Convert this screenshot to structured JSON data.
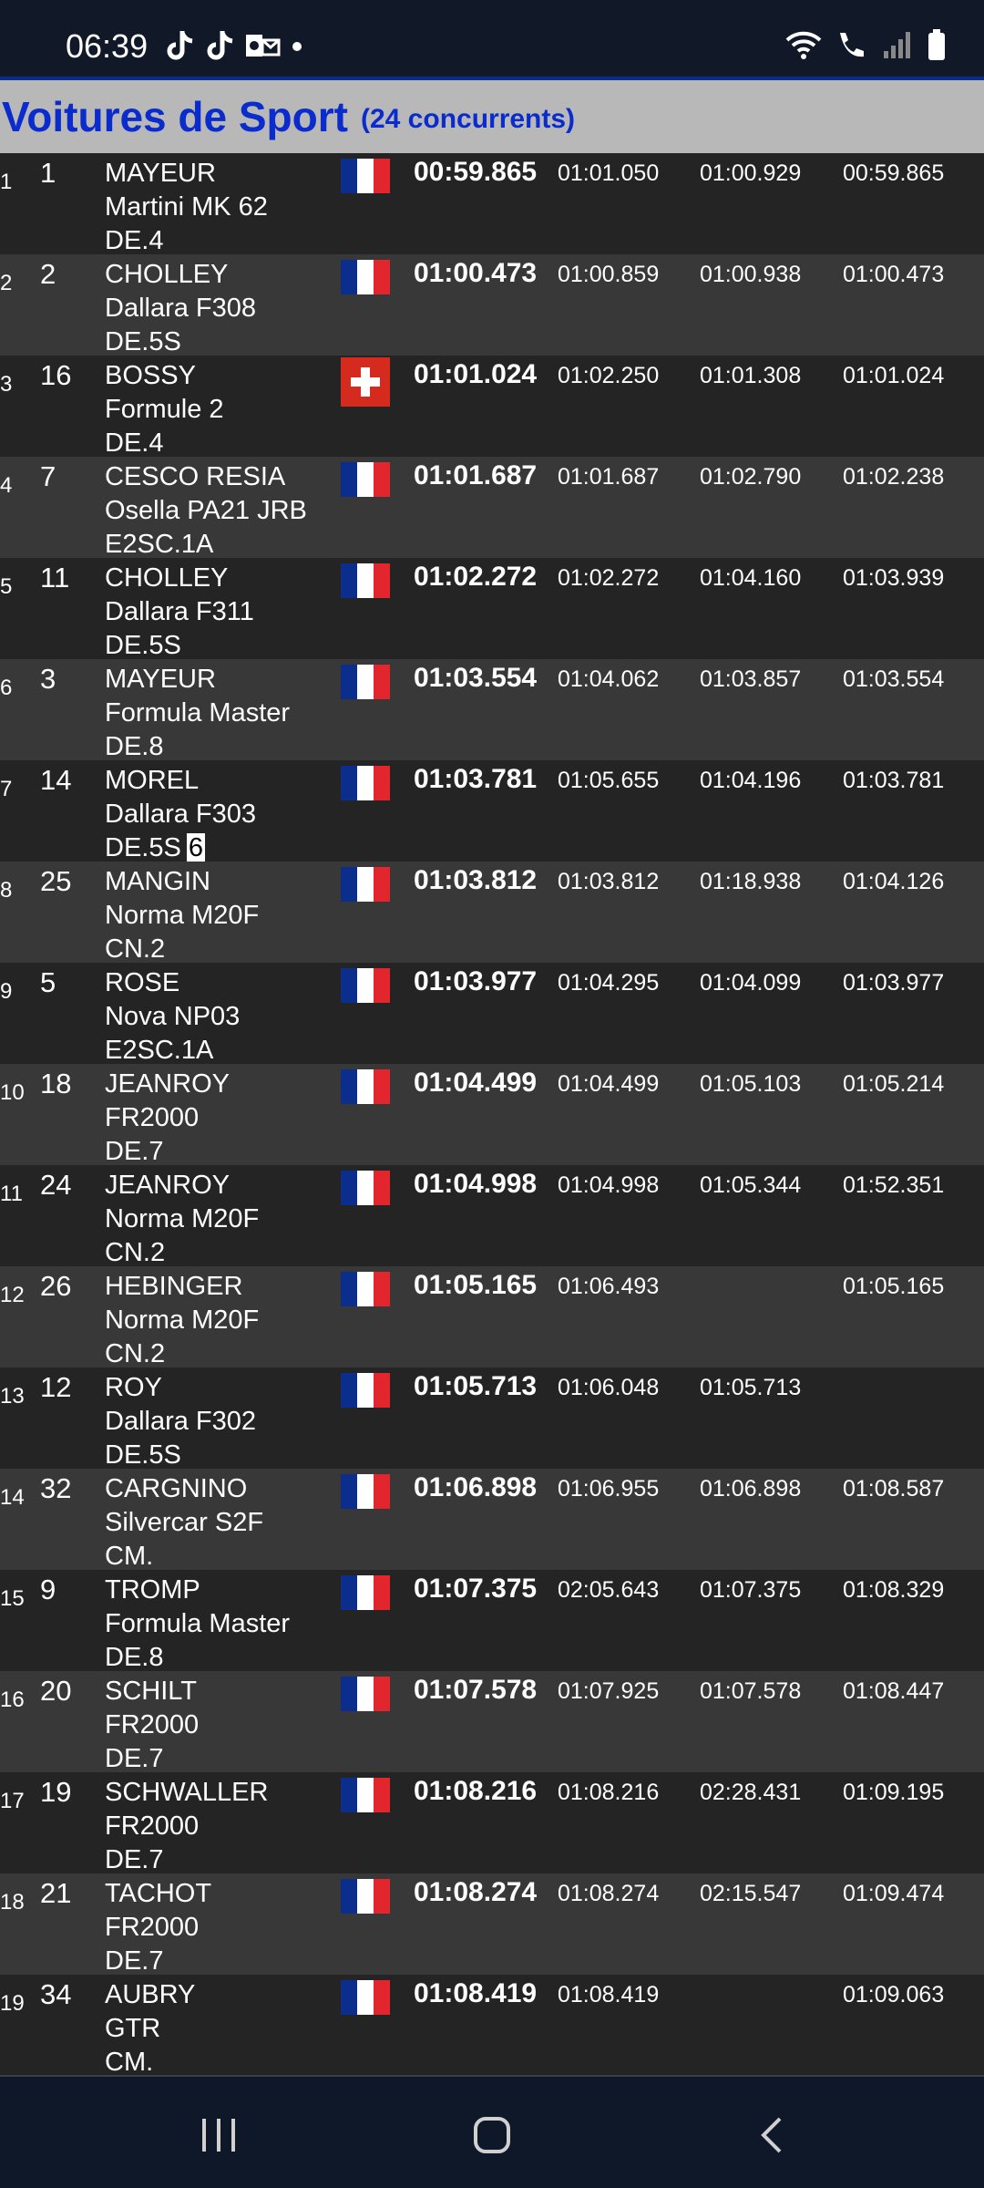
{
  "status_bar": {
    "time": "06:39",
    "notification_icons": [
      "tiktok-icon",
      "tiktok-icon",
      "outlook-icon",
      "dot-icon"
    ],
    "system_icons": [
      "wifi-icon",
      "wifi-call-icon",
      "signal-icon",
      "battery-icon"
    ]
  },
  "header": {
    "title": "Voitures de Sport",
    "count": "(24 concurrents)"
  },
  "colors": {
    "header_bg": "#b8b8b8",
    "title_blue": "#0b2ccc",
    "row_dark": "#242424",
    "row_light": "#383838",
    "flag_blue": "#0b2d8c",
    "flag_red": "#e1262d",
    "swiss_red": "#d52b1e"
  },
  "results": [
    {
      "pos": "1",
      "num": "1",
      "driver": "MAYEUR",
      "car": "Martini MK 62",
      "class": "DE.4",
      "flag": "FR",
      "best": "00:59.865",
      "lap1": "01:01.050",
      "lap2": "01:00.929",
      "lap3": "00:59.865"
    },
    {
      "pos": "2",
      "num": "2",
      "driver": "CHOLLEY",
      "car": "Dallara F308",
      "class": "DE.5S",
      "flag": "FR",
      "best": "01:00.473",
      "lap1": "01:00.859",
      "lap2": "01:00.938",
      "lap3": "01:00.473"
    },
    {
      "pos": "3",
      "num": "16",
      "driver": "BOSSY",
      "car": "Formule 2",
      "class": "DE.4",
      "flag": "CH",
      "best": "01:01.024",
      "lap1": "01:02.250",
      "lap2": "01:01.308",
      "lap3": "01:01.024"
    },
    {
      "pos": "4",
      "num": "7",
      "driver": "CESCO RESIA",
      "car": "Osella PA21 JRB",
      "class": "E2SC.1A",
      "flag": "FR",
      "best": "01:01.687",
      "lap1": "01:01.687",
      "lap2": "01:02.790",
      "lap3": "01:02.238"
    },
    {
      "pos": "5",
      "num": "11",
      "driver": "CHOLLEY",
      "car": "Dallara F311",
      "class": "DE.5S",
      "flag": "FR",
      "best": "01:02.272",
      "lap1": "01:02.272",
      "lap2": "01:04.160",
      "lap3": "01:03.939"
    },
    {
      "pos": "6",
      "num": "3",
      "driver": "MAYEUR",
      "car": "Formula Master",
      "class": "DE.8",
      "flag": "FR",
      "best": "01:03.554",
      "lap1": "01:04.062",
      "lap2": "01:03.857",
      "lap3": "01:03.554"
    },
    {
      "pos": "7",
      "num": "14",
      "driver": "MOREL",
      "car": "Dallara F303",
      "class": "DE.5S",
      "badge": "6",
      "flag": "FR",
      "best": "01:03.781",
      "lap1": "01:05.655",
      "lap2": "01:04.196",
      "lap3": "01:03.781"
    },
    {
      "pos": "8",
      "num": "25",
      "driver": "MANGIN",
      "car": "Norma M20F",
      "class": "CN.2",
      "flag": "FR",
      "best": "01:03.812",
      "lap1": "01:03.812",
      "lap2": "01:18.938",
      "lap3": "01:04.126"
    },
    {
      "pos": "9",
      "num": "5",
      "driver": "ROSE",
      "car": "Nova NP03",
      "class": "E2SC.1A",
      "flag": "FR",
      "best": "01:03.977",
      "lap1": "01:04.295",
      "lap2": "01:04.099",
      "lap3": "01:03.977"
    },
    {
      "pos": "10",
      "num": "18",
      "driver": "JEANROY",
      "car": "FR2000",
      "class": "DE.7",
      "flag": "FR",
      "best": "01:04.499",
      "lap1": "01:04.499",
      "lap2": "01:05.103",
      "lap3": "01:05.214"
    },
    {
      "pos": "11",
      "num": "24",
      "driver": "JEANROY",
      "car": "Norma M20F",
      "class": "CN.2",
      "flag": "FR",
      "best": "01:04.998",
      "lap1": "01:04.998",
      "lap2": "01:05.344",
      "lap3": "01:52.351"
    },
    {
      "pos": "12",
      "num": "26",
      "driver": "HEBINGER",
      "car": "Norma M20F",
      "class": "CN.2",
      "flag": "FR",
      "best": "01:05.165",
      "lap1": "01:06.493",
      "lap2": "",
      "lap3": "01:05.165"
    },
    {
      "pos": "13",
      "num": "12",
      "driver": "ROY",
      "car": "Dallara F302",
      "class": "DE.5S",
      "flag": "FR",
      "best": "01:05.713",
      "lap1": "01:06.048",
      "lap2": "01:05.713",
      "lap3": ""
    },
    {
      "pos": "14",
      "num": "32",
      "driver": "CARGNINO",
      "car": "Silvercar S2F",
      "class": "CM.",
      "flag": "FR",
      "best": "01:06.898",
      "lap1": "01:06.955",
      "lap2": "01:06.898",
      "lap3": "01:08.587"
    },
    {
      "pos": "15",
      "num": "9",
      "driver": "TROMP",
      "car": "Formula Master",
      "class": "DE.8",
      "flag": "FR",
      "best": "01:07.375",
      "lap1": "02:05.643",
      "lap2": "01:07.375",
      "lap3": "01:08.329"
    },
    {
      "pos": "16",
      "num": "20",
      "driver": "SCHILT",
      "car": "FR2000",
      "class": "DE.7",
      "flag": "FR",
      "best": "01:07.578",
      "lap1": "01:07.925",
      "lap2": "01:07.578",
      "lap3": "01:08.447"
    },
    {
      "pos": "17",
      "num": "19",
      "driver": "SCHWALLER",
      "car": "FR2000",
      "class": "DE.7",
      "flag": "FR",
      "best": "01:08.216",
      "lap1": "01:08.216",
      "lap2": "02:28.431",
      "lap3": "01:09.195"
    },
    {
      "pos": "18",
      "num": "21",
      "driver": "TACHOT",
      "car": "FR2000",
      "class": "DE.7",
      "flag": "FR",
      "best": "01:08.274",
      "lap1": "01:08.274",
      "lap2": "02:15.547",
      "lap3": "01:09.474"
    },
    {
      "pos": "19",
      "num": "34",
      "driver": "AUBRY",
      "car": "GTR",
      "class": "CM.",
      "flag": "FR",
      "best": "01:08.419",
      "lap1": "01:08.419",
      "lap2": "",
      "lap3": "01:09.063"
    }
  ],
  "nav_bar": {
    "buttons": [
      "recent-apps-icon",
      "home-icon",
      "back-icon"
    ]
  }
}
